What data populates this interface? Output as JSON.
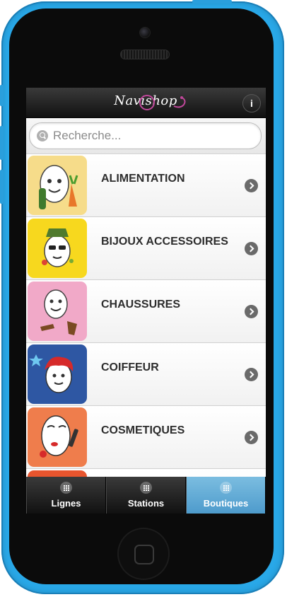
{
  "app": {
    "logo": "Navishop"
  },
  "search": {
    "placeholder": "Recherche..."
  },
  "categories": [
    {
      "label": "ALIMENTATION",
      "color": "#f6dc8a"
    },
    {
      "label": "BIJOUX ACCESSOIRES",
      "color": "#f7d81e"
    },
    {
      "label": "CHAUSSURES",
      "color": "#f1a9c8"
    },
    {
      "label": "COIFFEUR",
      "color": "#2e57a3"
    },
    {
      "label": "COSMETIQUES",
      "color": "#ef7d4c"
    }
  ],
  "partial_item_color": "#e8552e",
  "tabs": [
    {
      "label": "Lignes",
      "active": false
    },
    {
      "label": "Stations",
      "active": false
    },
    {
      "label": "Boutiques",
      "active": true
    }
  ],
  "colors": {
    "phone": "#29a8e8",
    "active_tab": "#5aa6d4",
    "logo_accent": "#c0479a"
  }
}
